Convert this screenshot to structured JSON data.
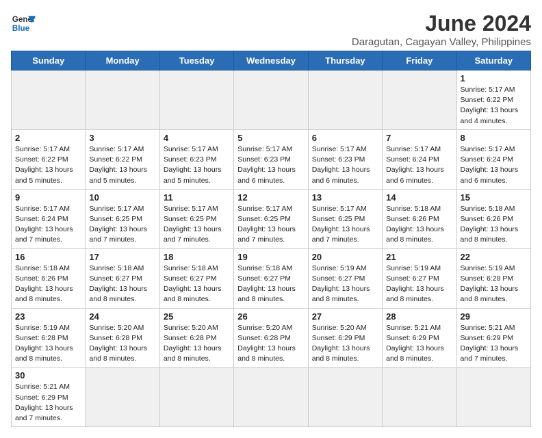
{
  "logo": {
    "line1": "General",
    "line2": "Blue"
  },
  "title": "June 2024",
  "subtitle": "Daragutan, Cagayan Valley, Philippines",
  "days_of_week": [
    "Sunday",
    "Monday",
    "Tuesday",
    "Wednesday",
    "Thursday",
    "Friday",
    "Saturday"
  ],
  "weeks": [
    [
      {
        "date": "",
        "info": ""
      },
      {
        "date": "",
        "info": ""
      },
      {
        "date": "",
        "info": ""
      },
      {
        "date": "",
        "info": ""
      },
      {
        "date": "",
        "info": ""
      },
      {
        "date": "",
        "info": ""
      },
      {
        "date": "1",
        "info": "Sunrise: 5:17 AM\nSunset: 6:22 PM\nDaylight: 13 hours and 4 minutes."
      }
    ],
    [
      {
        "date": "2",
        "info": "Sunrise: 5:17 AM\nSunset: 6:22 PM\nDaylight: 13 hours and 5 minutes."
      },
      {
        "date": "3",
        "info": "Sunrise: 5:17 AM\nSunset: 6:22 PM\nDaylight: 13 hours and 5 minutes."
      },
      {
        "date": "4",
        "info": "Sunrise: 5:17 AM\nSunset: 6:23 PM\nDaylight: 13 hours and 5 minutes."
      },
      {
        "date": "5",
        "info": "Sunrise: 5:17 AM\nSunset: 6:23 PM\nDaylight: 13 hours and 6 minutes."
      },
      {
        "date": "6",
        "info": "Sunrise: 5:17 AM\nSunset: 6:23 PM\nDaylight: 13 hours and 6 minutes."
      },
      {
        "date": "7",
        "info": "Sunrise: 5:17 AM\nSunset: 6:24 PM\nDaylight: 13 hours and 6 minutes."
      },
      {
        "date": "8",
        "info": "Sunrise: 5:17 AM\nSunset: 6:24 PM\nDaylight: 13 hours and 6 minutes."
      }
    ],
    [
      {
        "date": "9",
        "info": "Sunrise: 5:17 AM\nSunset: 6:24 PM\nDaylight: 13 hours and 7 minutes."
      },
      {
        "date": "10",
        "info": "Sunrise: 5:17 AM\nSunset: 6:25 PM\nDaylight: 13 hours and 7 minutes."
      },
      {
        "date": "11",
        "info": "Sunrise: 5:17 AM\nSunset: 6:25 PM\nDaylight: 13 hours and 7 minutes."
      },
      {
        "date": "12",
        "info": "Sunrise: 5:17 AM\nSunset: 6:25 PM\nDaylight: 13 hours and 7 minutes."
      },
      {
        "date": "13",
        "info": "Sunrise: 5:17 AM\nSunset: 6:25 PM\nDaylight: 13 hours and 7 minutes."
      },
      {
        "date": "14",
        "info": "Sunrise: 5:18 AM\nSunset: 6:26 PM\nDaylight: 13 hours and 8 minutes."
      },
      {
        "date": "15",
        "info": "Sunrise: 5:18 AM\nSunset: 6:26 PM\nDaylight: 13 hours and 8 minutes."
      }
    ],
    [
      {
        "date": "16",
        "info": "Sunrise: 5:18 AM\nSunset: 6:26 PM\nDaylight: 13 hours and 8 minutes."
      },
      {
        "date": "17",
        "info": "Sunrise: 5:18 AM\nSunset: 6:27 PM\nDaylight: 13 hours and 8 minutes."
      },
      {
        "date": "18",
        "info": "Sunrise: 5:18 AM\nSunset: 6:27 PM\nDaylight: 13 hours and 8 minutes."
      },
      {
        "date": "19",
        "info": "Sunrise: 5:18 AM\nSunset: 6:27 PM\nDaylight: 13 hours and 8 minutes."
      },
      {
        "date": "20",
        "info": "Sunrise: 5:19 AM\nSunset: 6:27 PM\nDaylight: 13 hours and 8 minutes."
      },
      {
        "date": "21",
        "info": "Sunrise: 5:19 AM\nSunset: 6:27 PM\nDaylight: 13 hours and 8 minutes."
      },
      {
        "date": "22",
        "info": "Sunrise: 5:19 AM\nSunset: 6:28 PM\nDaylight: 13 hours and 8 minutes."
      }
    ],
    [
      {
        "date": "23",
        "info": "Sunrise: 5:19 AM\nSunset: 6:28 PM\nDaylight: 13 hours and 8 minutes."
      },
      {
        "date": "24",
        "info": "Sunrise: 5:20 AM\nSunset: 6:28 PM\nDaylight: 13 hours and 8 minutes."
      },
      {
        "date": "25",
        "info": "Sunrise: 5:20 AM\nSunset: 6:28 PM\nDaylight: 13 hours and 8 minutes."
      },
      {
        "date": "26",
        "info": "Sunrise: 5:20 AM\nSunset: 6:28 PM\nDaylight: 13 hours and 8 minutes."
      },
      {
        "date": "27",
        "info": "Sunrise: 5:20 AM\nSunset: 6:29 PM\nDaylight: 13 hours and 8 minutes."
      },
      {
        "date": "28",
        "info": "Sunrise: 5:21 AM\nSunset: 6:29 PM\nDaylight: 13 hours and 8 minutes."
      },
      {
        "date": "29",
        "info": "Sunrise: 5:21 AM\nSunset: 6:29 PM\nDaylight: 13 hours and 7 minutes."
      }
    ],
    [
      {
        "date": "30",
        "info": "Sunrise: 5:21 AM\nSunset: 6:29 PM\nDaylight: 13 hours and 7 minutes."
      },
      {
        "date": "",
        "info": ""
      },
      {
        "date": "",
        "info": ""
      },
      {
        "date": "",
        "info": ""
      },
      {
        "date": "",
        "info": ""
      },
      {
        "date": "",
        "info": ""
      },
      {
        "date": "",
        "info": ""
      }
    ]
  ]
}
